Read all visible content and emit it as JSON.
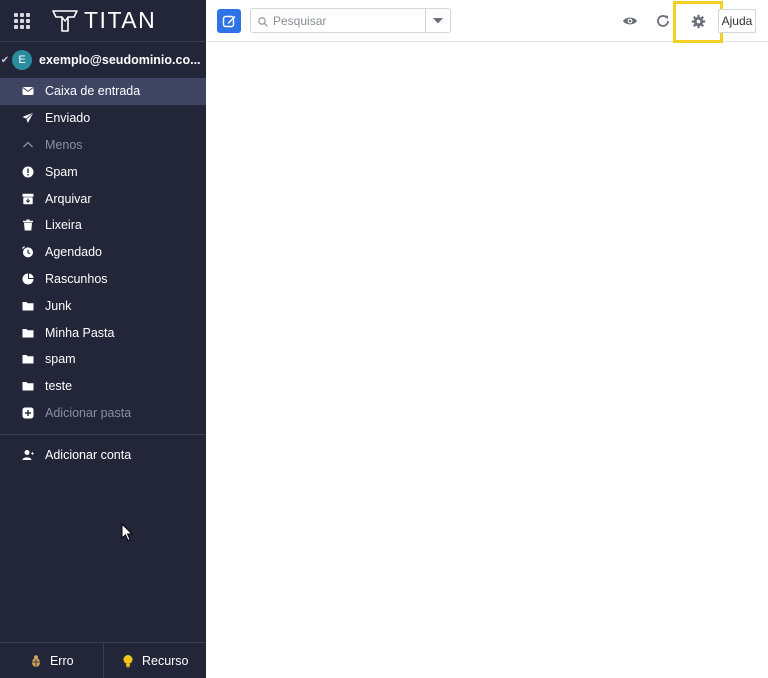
{
  "brand": {
    "logo_text": "TITAN"
  },
  "account": {
    "avatar_letter": "E",
    "email": "exemplo@seudominio.co..."
  },
  "folders": [
    {
      "label": "Caixa de entrada",
      "icon": "inbox-icon",
      "active": true
    },
    {
      "label": "Enviado",
      "icon": "send-icon"
    },
    {
      "label": "Menos",
      "icon": "chevron-up-icon",
      "muted": true
    },
    {
      "label": "Spam",
      "icon": "alert-icon"
    },
    {
      "label": "Arquivar",
      "icon": "archive-icon"
    },
    {
      "label": "Lixeira",
      "icon": "trash-icon"
    },
    {
      "label": "Agendado",
      "icon": "clock-icon"
    },
    {
      "label": "Rascunhos",
      "icon": "drafts-icon"
    },
    {
      "label": "Junk",
      "icon": "folder-icon"
    },
    {
      "label": "Minha Pasta",
      "icon": "folder-icon"
    },
    {
      "label": "spam",
      "icon": "folder-icon"
    },
    {
      "label": "teste",
      "icon": "folder-icon"
    },
    {
      "label": "Adicionar pasta",
      "icon": "add-folder-icon",
      "muted": true
    }
  ],
  "add_account": {
    "label": "Adicionar conta"
  },
  "footer": {
    "error_label": "Erro",
    "feature_label": "Recurso"
  },
  "topbar": {
    "search_placeholder": "Pesquisar",
    "help_label": "Ajuda"
  },
  "colors": {
    "sidebar_bg": "#222638",
    "active_bg": "#3f4463",
    "accent": "#2e73e6",
    "highlight": "#f2d024"
  }
}
